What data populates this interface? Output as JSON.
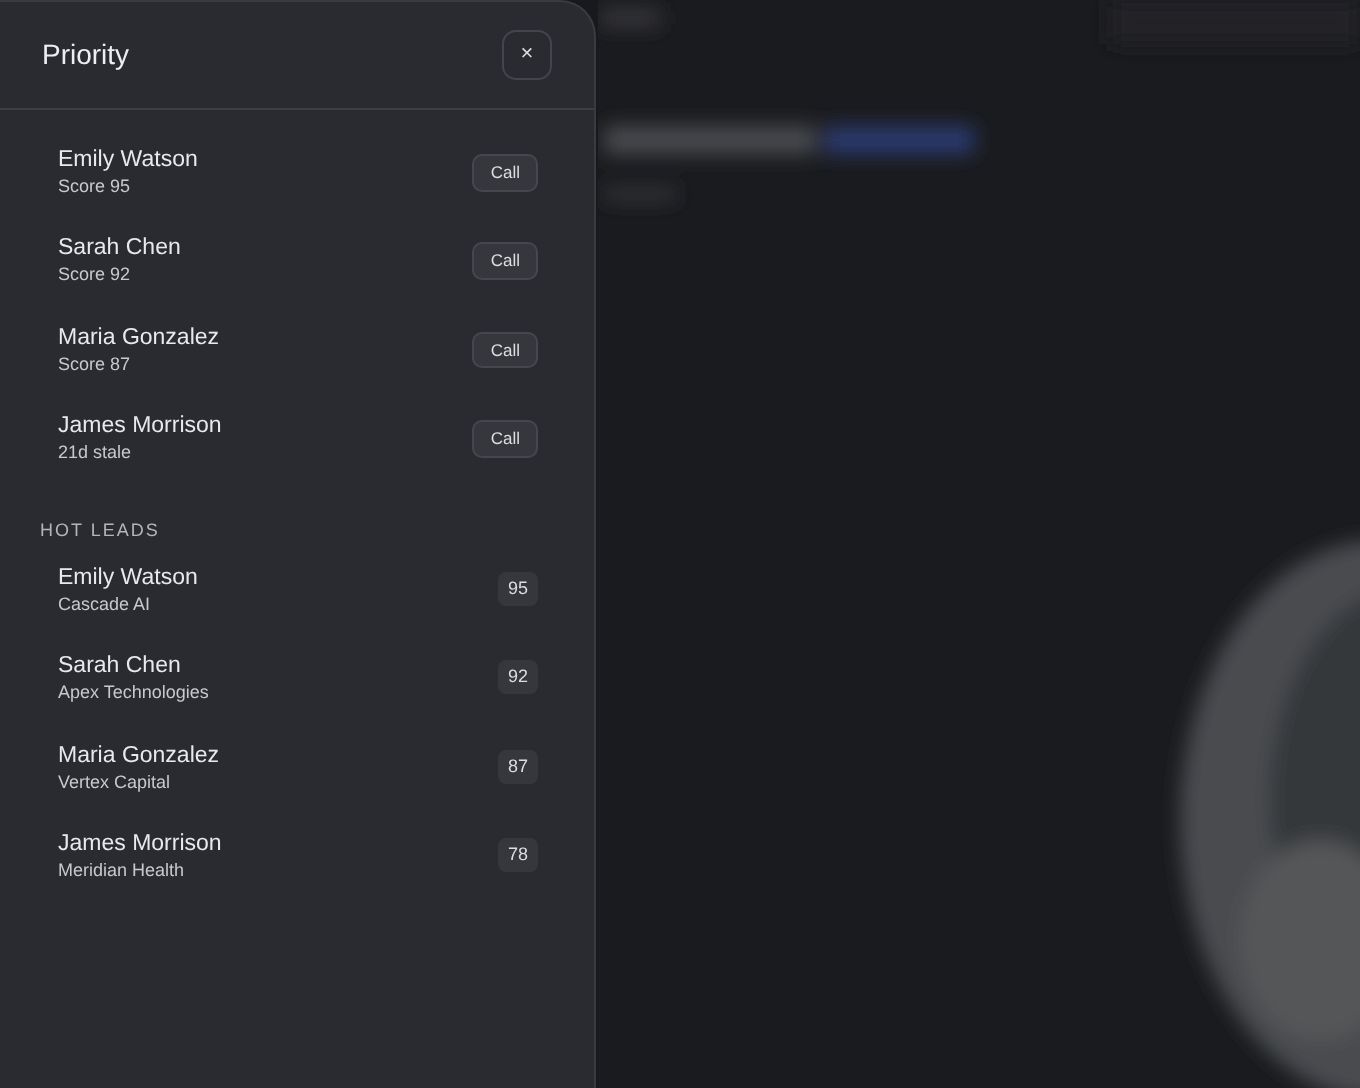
{
  "panel": {
    "title": "Priority",
    "close": "×"
  },
  "priority": [
    {
      "name": "Emily Watson",
      "detail": "Score 95",
      "action": "Call"
    },
    {
      "name": "Sarah Chen",
      "detail": "Score 92",
      "action": "Call"
    },
    {
      "name": "Maria Gonzalez",
      "detail": "Score 87",
      "action": "Call"
    },
    {
      "name": "James Morrison",
      "detail": "21d stale",
      "action": "Call"
    }
  ],
  "hot_leads": {
    "heading": "HOT LEADS",
    "items": [
      {
        "name": "Emily Watson",
        "company": "Cascade AI",
        "score": "95"
      },
      {
        "name": "Sarah Chen",
        "company": "Apex Technologies",
        "score": "92"
      },
      {
        "name": "Maria Gonzalez",
        "company": "Vertex Capital",
        "score": "87"
      },
      {
        "name": "James Morrison",
        "company": "Meridian Health",
        "score": "78"
      }
    ]
  }
}
